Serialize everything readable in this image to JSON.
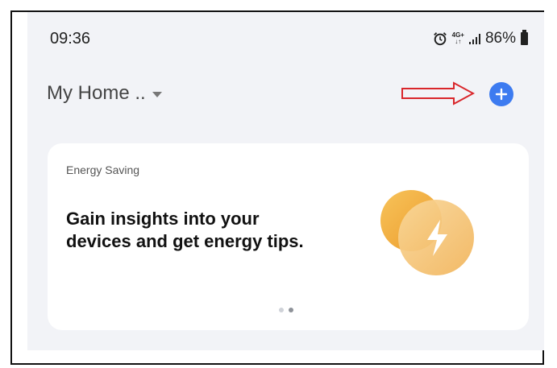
{
  "status_bar": {
    "time": "09:36",
    "network": "4G+",
    "battery_percent": "86%",
    "icons": [
      "alarm-icon",
      "network-4g-icon",
      "signal-icon",
      "battery-icon"
    ]
  },
  "header": {
    "home_name": "My Home ..",
    "add_icon": "plus-icon"
  },
  "colors": {
    "accent": "#3d7bf0",
    "annotation": "#d9262b",
    "energy_orange": "#f2a93b"
  },
  "card": {
    "label": "Energy Saving",
    "headline": "Gain insights into your devices and get energy tips.",
    "icon": "lightning-bolt-icon",
    "pagination": {
      "total": 2,
      "active": 2
    }
  }
}
